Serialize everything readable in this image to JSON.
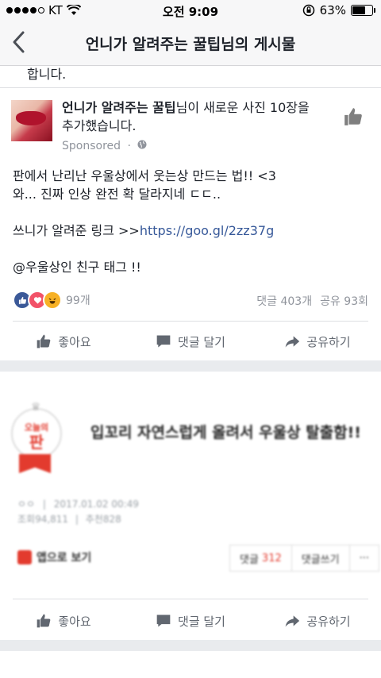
{
  "status_bar": {
    "carrier": "KT",
    "time": "오전 9:09",
    "battery": "63%",
    "battery_level": 0.63
  },
  "nav": {
    "back_icon": "chevron-left-icon",
    "title": "언니가 알려주는 꿀팁님의 게시물"
  },
  "previous_post_tail": "합니다.",
  "post": {
    "page_name": "언니가 알려주는 꿀팁",
    "header_rest": "님이 새로운 사진 10장을 추가했습니다.",
    "sponsored": "Sponsored",
    "body_line1": "판에서 난리난 우울상에서 웃는상 만드는 법!! <3",
    "body_line2": "와... 진짜 인상 완전 확 달라지네 ㄷㄷ..",
    "body_line3_prefix": "쓰니가 알려준 링크 >>",
    "link": "https://goo.gl/2zz37g",
    "body_line4": "@우울상인 친구 태그 !!",
    "reaction_count": "99개",
    "comments": "댓글 403개",
    "shares": "공유 93회"
  },
  "actions": {
    "like": "좋아요",
    "comment": "댓글 달기",
    "share": "공유하기"
  },
  "card": {
    "badge_line1": "오늘의",
    "badge_line2": "판",
    "title": "입꼬리 자연스럽게 올려서 우울상 탈출함!!",
    "meta_user": "ㅇㅇ",
    "meta_date": "2017.01.02 00:49",
    "meta_views": "조회94,811",
    "meta_recommend": "추천828",
    "app_button": "앱으로 보기",
    "comment_label": "댓글",
    "comment_count": "312",
    "write_comment": "댓글쓰기",
    "more": "···"
  }
}
